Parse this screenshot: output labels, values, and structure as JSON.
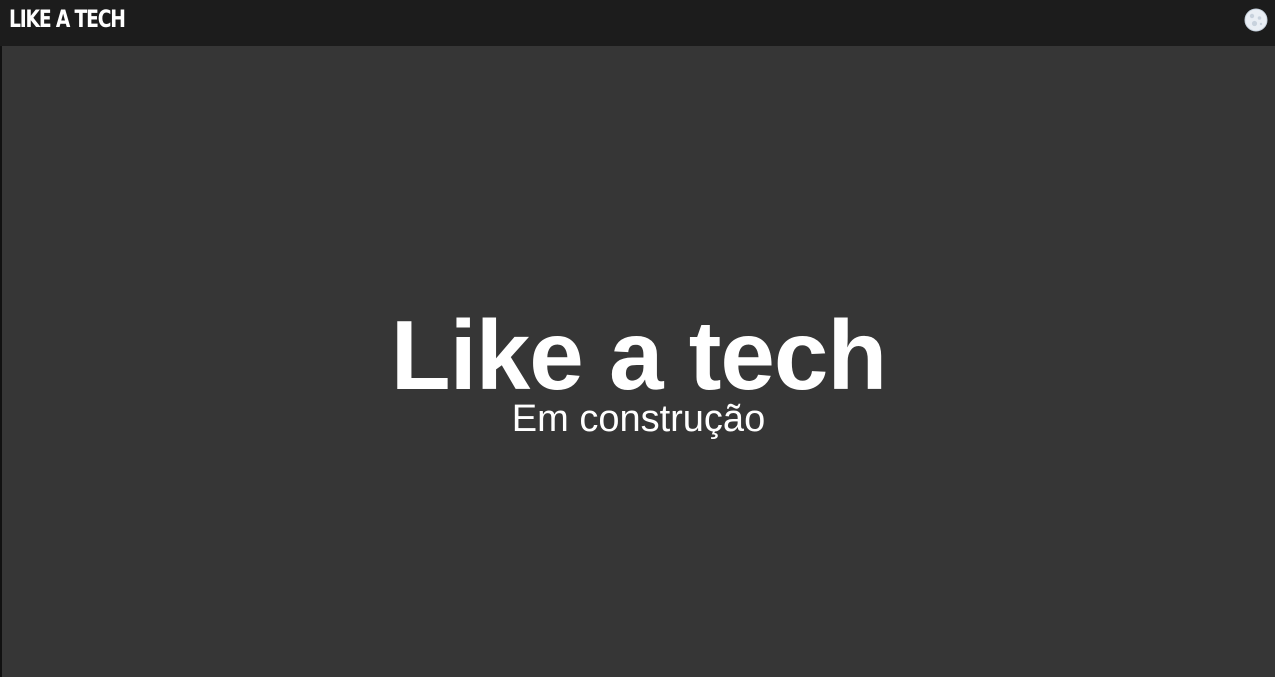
{
  "header": {
    "brand": "LIKE A TECH",
    "theme_toggle_icon": "moon-icon"
  },
  "hero": {
    "title": "Like a tech",
    "subtitle": "Em construção"
  },
  "colors": {
    "header_bg": "#1c1c1c",
    "page_bg": "#363636",
    "text": "#ffffff"
  }
}
